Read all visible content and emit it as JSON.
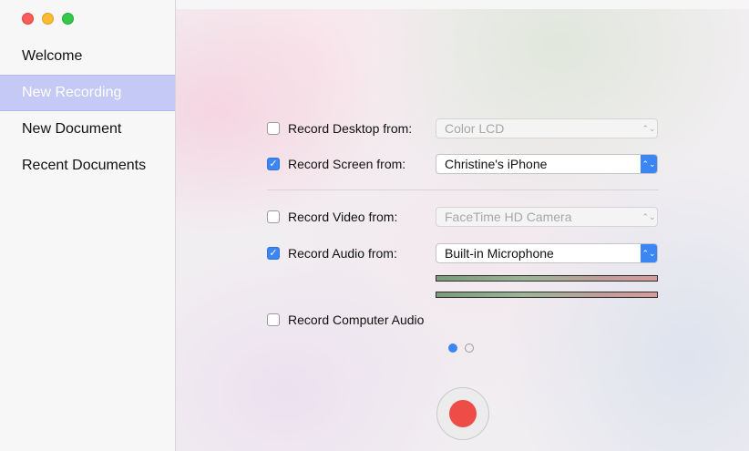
{
  "sidebar": {
    "items": [
      {
        "label": "Welcome"
      },
      {
        "label": "New Recording"
      },
      {
        "label": "New Document"
      },
      {
        "label": "Recent Documents"
      }
    ],
    "selected": "New Recording"
  },
  "recording": {
    "desktop": {
      "label": "Record Desktop from:",
      "checked": false,
      "source": "Color LCD"
    },
    "screen": {
      "label": "Record Screen from:",
      "checked": true,
      "source": "Christine's iPhone"
    },
    "video": {
      "label": "Record Video from:",
      "checked": false,
      "source": "FaceTime HD Camera"
    },
    "audio": {
      "label": "Record Audio from:",
      "checked": true,
      "source": "Built-in Microphone"
    },
    "computer_audio": {
      "label": "Record Computer Audio",
      "checked": false
    }
  },
  "pager": {
    "pages": 2,
    "current": 1
  },
  "icons": {
    "checkmark": "✓",
    "stepper": "⌃⌄"
  },
  "colors": {
    "accent": "#3b86f4",
    "selection": "#c4c9f6",
    "record": "#ed4c47"
  }
}
